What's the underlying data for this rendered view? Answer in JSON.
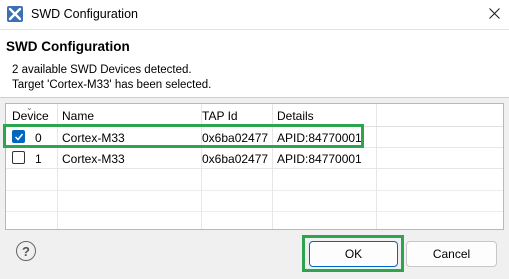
{
  "window": {
    "title": "SWD Configuration",
    "icon": "app-x-icon"
  },
  "header": {
    "title": "SWD Configuration",
    "message_line1": "2 available SWD Devices detected.",
    "message_line2": "Target 'Cortex-M33' has been selected."
  },
  "table": {
    "columns": [
      "Device",
      "Name",
      "TAP Id",
      "Details"
    ],
    "rows": [
      {
        "checked": true,
        "device": "0",
        "name": "Cortex-M33",
        "tap_id": "0x6ba02477",
        "details": "APID:84770001"
      },
      {
        "checked": false,
        "device": "1",
        "name": "Cortex-M33",
        "tap_id": "0x6ba02477",
        "details": "APID:84770001"
      }
    ]
  },
  "buttons": {
    "ok": "OK",
    "cancel": "Cancel",
    "help": "?"
  },
  "colors": {
    "highlight": "#2ea44f",
    "accent": "#0067c0"
  }
}
